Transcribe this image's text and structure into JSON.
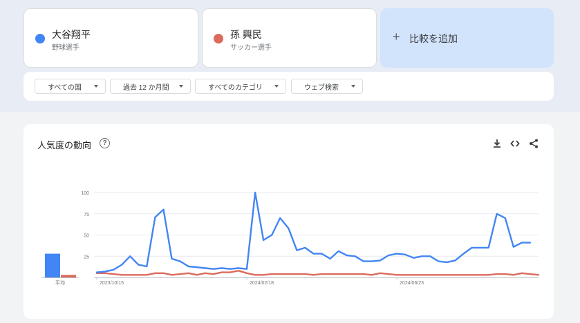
{
  "terms": [
    {
      "name": "大谷翔平",
      "subtitle": "野球選手",
      "color": "#4285f4"
    },
    {
      "name": "孫 興民",
      "subtitle": "サッカー選手",
      "color": "#db6b5c"
    }
  ],
  "add_compare": {
    "label": "比較を追加",
    "icon": "plus-icon"
  },
  "filters": {
    "country": "すべての国",
    "period": "過去 12 か月間",
    "category": "すべてのカテゴリ",
    "search_type": "ウェブ検索"
  },
  "chart_card": {
    "title": "人気度の動向",
    "help_icon": "question-circle-icon",
    "tools": [
      "download-icon",
      "embed-code-icon",
      "share-icon"
    ]
  },
  "chart_data": {
    "type": "line",
    "title": "人気度の動向",
    "xlabel": "",
    "ylabel": "",
    "ylim": [
      0,
      100
    ],
    "yticks": [
      25,
      50,
      75,
      100
    ],
    "xtick_labels": [
      "2023/10/15",
      "2024/02/18",
      "2024/06/23"
    ],
    "xtick_indices": [
      0,
      18,
      36
    ],
    "grid": true,
    "average_label": "平均",
    "average": [
      28,
      3
    ],
    "series": [
      {
        "color": "#4285f4",
        "values": [
          6,
          7,
          9,
          15,
          25,
          15,
          13,
          71,
          80,
          22,
          19,
          13,
          12,
          11,
          10,
          11,
          10,
          11,
          10,
          100,
          44,
          50,
          70,
          58,
          32,
          35,
          28,
          28,
          22,
          31,
          26,
          25,
          19,
          19,
          20,
          26,
          28,
          27,
          23,
          25,
          25,
          19,
          18,
          20,
          28,
          35,
          35,
          35,
          75,
          70,
          36,
          41,
          41
        ]
      },
      {
        "color": "#db6b5c",
        "values": [
          5,
          5,
          4,
          3,
          3,
          3,
          3,
          5,
          5,
          3,
          4,
          5,
          3,
          5,
          4,
          6,
          6,
          8,
          5,
          3,
          3,
          4,
          4,
          4,
          4,
          4,
          3,
          4,
          4,
          4,
          4,
          4,
          4,
          3,
          5,
          4,
          3,
          3,
          3,
          3,
          3,
          3,
          3,
          3,
          3,
          3,
          3,
          3,
          4,
          4,
          3,
          5,
          4,
          3
        ]
      }
    ]
  }
}
